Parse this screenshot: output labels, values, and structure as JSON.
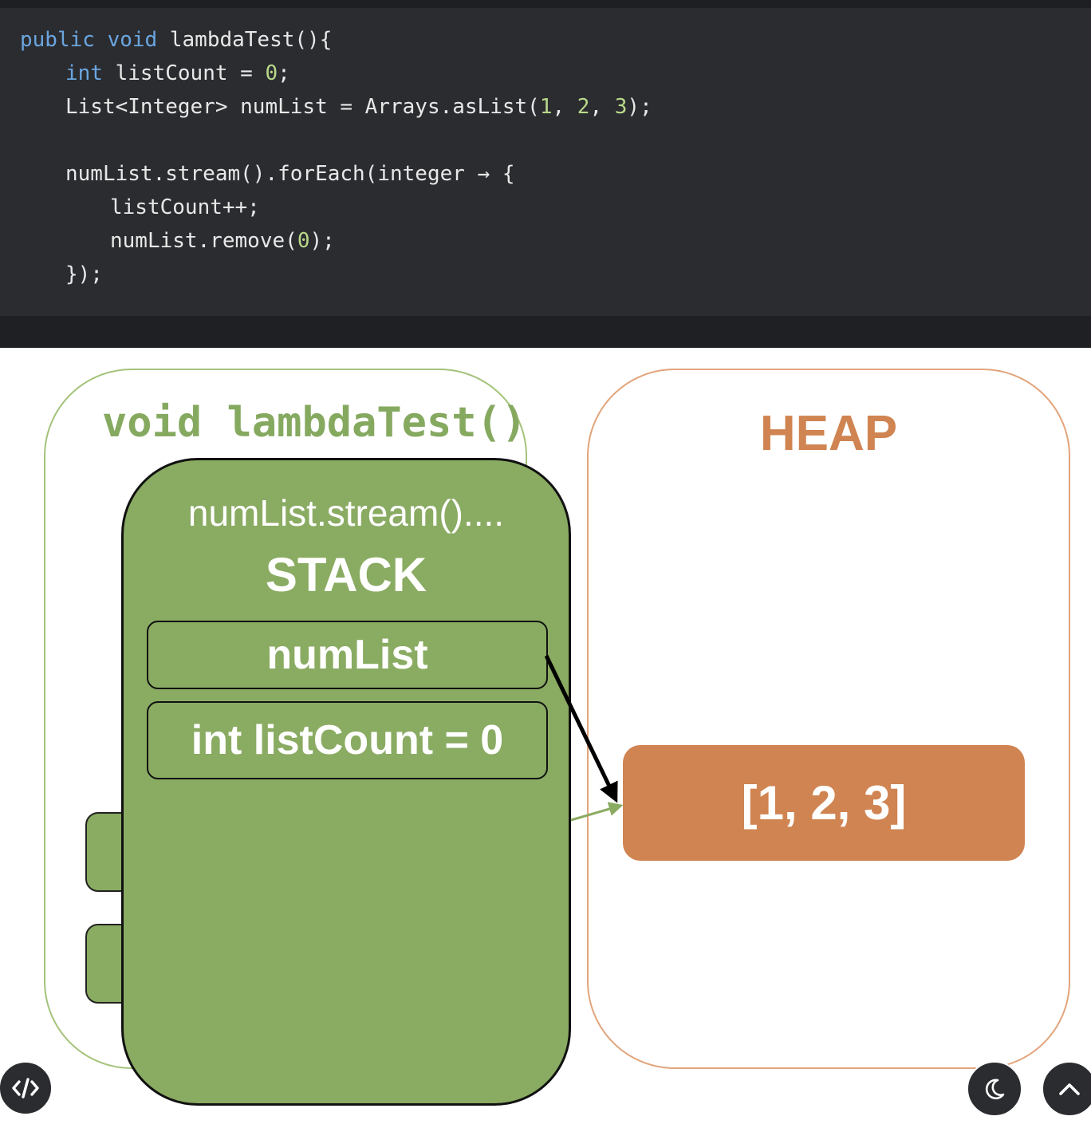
{
  "code": {
    "line1": {
      "kw1": "public",
      "kw2": "void",
      "rest": "lambdaTest(){"
    },
    "line2": {
      "kw": "int",
      "mid": "listCount = ",
      "num": "0",
      "end": ";"
    },
    "line3": {
      "start": "List<Integer> numList = Arrays.asList(",
      "n1": "1",
      "sep1": ", ",
      "n2": "2",
      "sep2": ", ",
      "n3": "3",
      "end": ");"
    },
    "line4": "numList.stream().forEach(integer → {",
    "line5": "listCount++;",
    "line6": {
      "start": "numList.remove(",
      "num": "0",
      "end": ");"
    },
    "line7": "});"
  },
  "diagram": {
    "method_label": "void lambdaTest()",
    "heap_title": "HEAP",
    "frame_title": "numList.stream()....",
    "stack_title": "STACK",
    "slot_numlist": "numList",
    "slot_listcount": "int listCount = 0",
    "heap_array": "[1, 2, 3]"
  },
  "colors": {
    "code_bg": "#2b2c30",
    "keyword": "#6aa6e0",
    "number": "#b9d98a",
    "stack_green": "#8aab62",
    "heap_orange": "#d08451"
  },
  "controls": {
    "code_toggle_icon": "code-icon",
    "theme_toggle_icon": "moon-icon",
    "scroll_top_icon": "chevron-up-icon"
  }
}
